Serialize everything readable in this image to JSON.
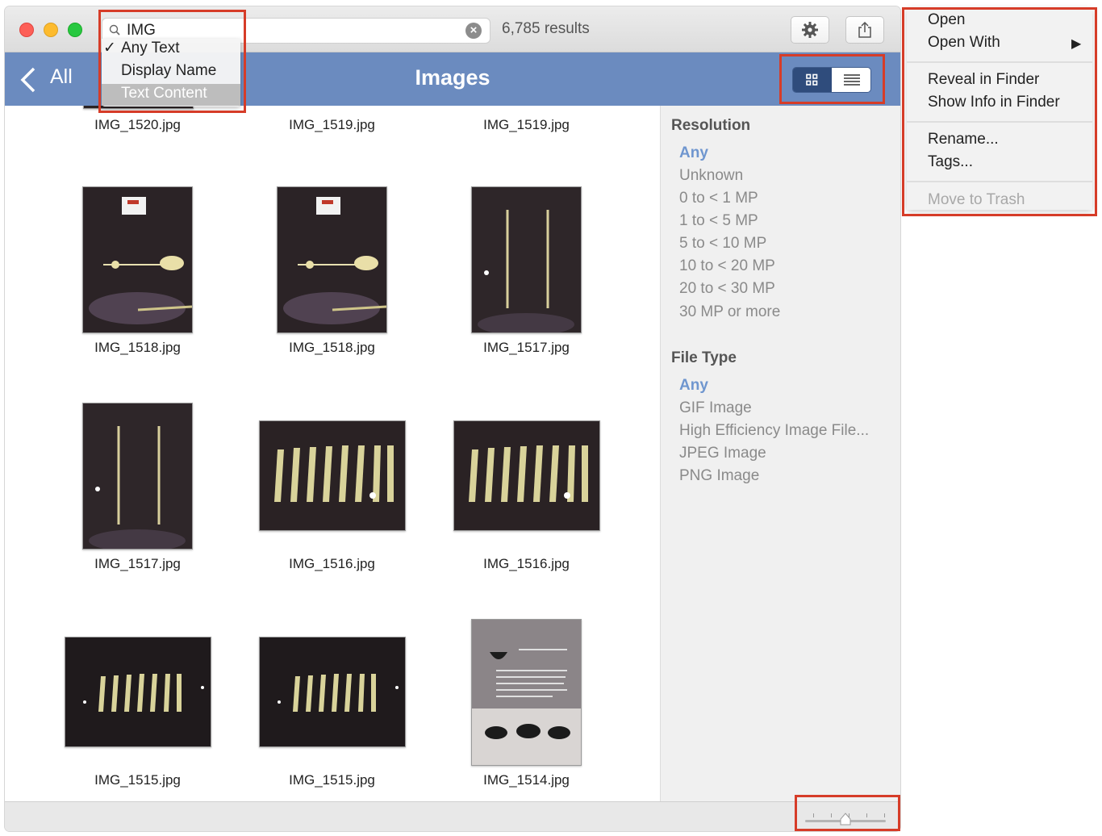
{
  "search": {
    "query": "IMG",
    "results_count": "6,785 results",
    "scope_options": [
      {
        "label": "Any Text",
        "checked": true
      },
      {
        "label": "Display Name",
        "checked": false
      },
      {
        "label": "Text Content",
        "checked": false
      }
    ]
  },
  "nav": {
    "back_label": "All",
    "title": "Images"
  },
  "thumbnails": [
    {
      "label": "IMG_1520.jpg"
    },
    {
      "label": "IMG_1519.jpg"
    },
    {
      "label": "IMG_1519.jpg"
    },
    {
      "label": "IMG_1518.jpg"
    },
    {
      "label": "IMG_1518.jpg"
    },
    {
      "label": "IMG_1517.jpg"
    },
    {
      "label": "IMG_1517.jpg"
    },
    {
      "label": "IMG_1516.jpg"
    },
    {
      "label": "IMG_1516.jpg"
    },
    {
      "label": "IMG_1515.jpg"
    },
    {
      "label": "IMG_1515.jpg"
    },
    {
      "label": "IMG_1514.jpg"
    }
  ],
  "filters": {
    "resolution": {
      "heading": "Resolution",
      "items": [
        "Any",
        "Unknown",
        "0 to < 1 MP",
        "1 to < 5 MP",
        "5 to < 10 MP",
        "10 to < 20 MP",
        "20 to < 30 MP",
        "30 MP or more"
      ]
    },
    "file_type": {
      "heading": "File Type",
      "items": [
        "Any",
        "GIF Image",
        "High Efficiency Image File...",
        "JPEG Image",
        "PNG Image"
      ]
    }
  },
  "context_menu": {
    "items": [
      "Open",
      "Open With",
      "Reveal in Finder",
      "Show Info in Finder",
      "Rename...",
      "Tags...",
      "Move to Trash"
    ]
  },
  "zoom": {
    "level": 0.5
  },
  "colors": {
    "nav_bar": "#6b8bbf",
    "accent": "#6f96cf",
    "annotation": "#d63c28"
  }
}
